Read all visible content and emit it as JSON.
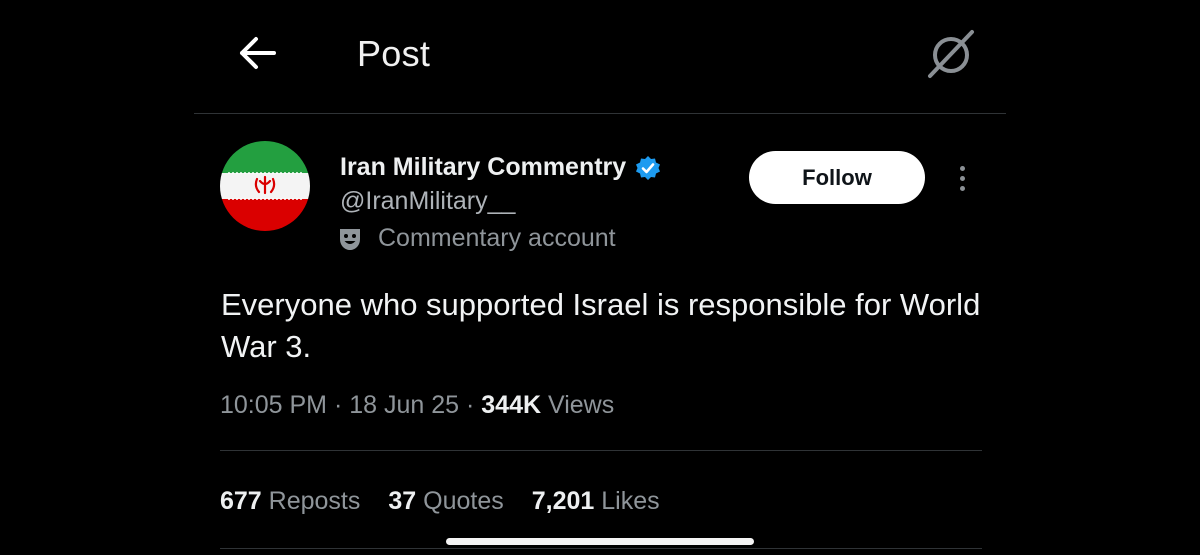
{
  "header": {
    "title": "Post",
    "back_icon": "back-arrow-icon",
    "grok_icon": "grok-icon"
  },
  "author": {
    "name": "Iran Military Commentry",
    "handle": "@IranMilitary__",
    "label": "Commentary account",
    "avatar": "iran-flag-avatar",
    "verified_color": "#1d9bf0"
  },
  "follow_label": "Follow",
  "post": {
    "text": "Everyone who supported Israel is responsible for World War 3.",
    "time": "10:05 PM",
    "sep1": " · ",
    "date": "18 Jun 25",
    "sep2": " · ",
    "views_count": "344K",
    "views_label": " Views"
  },
  "stats": [
    {
      "count": "677",
      "label": " Reposts"
    },
    {
      "count": "37",
      "label": " Quotes"
    },
    {
      "count": "7,201",
      "label": " Likes"
    }
  ]
}
